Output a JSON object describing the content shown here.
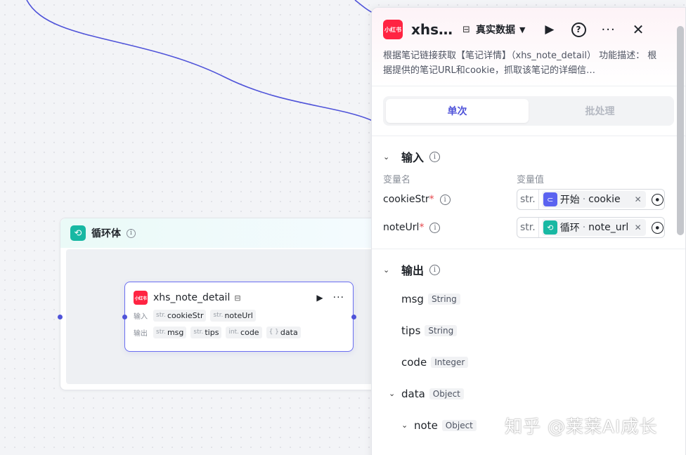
{
  "loop": {
    "title": "循环体"
  },
  "node": {
    "logo": "小红书",
    "title": "xhs_note_detail",
    "input_label": "输入",
    "output_label": "输出",
    "inputs": [
      {
        "type": "str.",
        "name": "cookieStr"
      },
      {
        "type": "str.",
        "name": "noteUrl"
      }
    ],
    "outputs": [
      {
        "type": "str.",
        "name": "msg"
      },
      {
        "type": "str.",
        "name": "tips"
      },
      {
        "type": "int.",
        "name": "code"
      },
      {
        "type": "{ }",
        "name": "data"
      }
    ]
  },
  "panel": {
    "logo": "小红书",
    "title": "xhs…",
    "mode": "真实数据",
    "description": "根据笔记链接获取【笔记详情】（xhs_note_detail） 功能描述： 根据提供的笔记URL和cookie，抓取该笔记的详细信…",
    "tabs": [
      "单次",
      "批处理"
    ],
    "input_section": {
      "title": "输入",
      "col_name": "变量名",
      "col_value": "变量值",
      "rows": [
        {
          "name": "cookieStr",
          "type": "str.",
          "source": "开始",
          "field": "cookie",
          "color": "#5b63f0"
        },
        {
          "name": "noteUrl",
          "type": "str.",
          "source": "循环",
          "field": "note_url",
          "color": "#18b8a3"
        }
      ]
    },
    "output_section": {
      "title": "输出",
      "rows": [
        {
          "name": "msg",
          "type": "String"
        },
        {
          "name": "tips",
          "type": "String"
        },
        {
          "name": "code",
          "type": "Integer"
        },
        {
          "name": "data",
          "type": "Object"
        },
        {
          "name": "note",
          "type": "Object"
        }
      ]
    }
  },
  "watermark": "知乎 @莱莱AI成长",
  "colors": {
    "accent": "#4f53d9",
    "xhs_red": "#ff2442",
    "loop_teal": "#18b8a3"
  }
}
